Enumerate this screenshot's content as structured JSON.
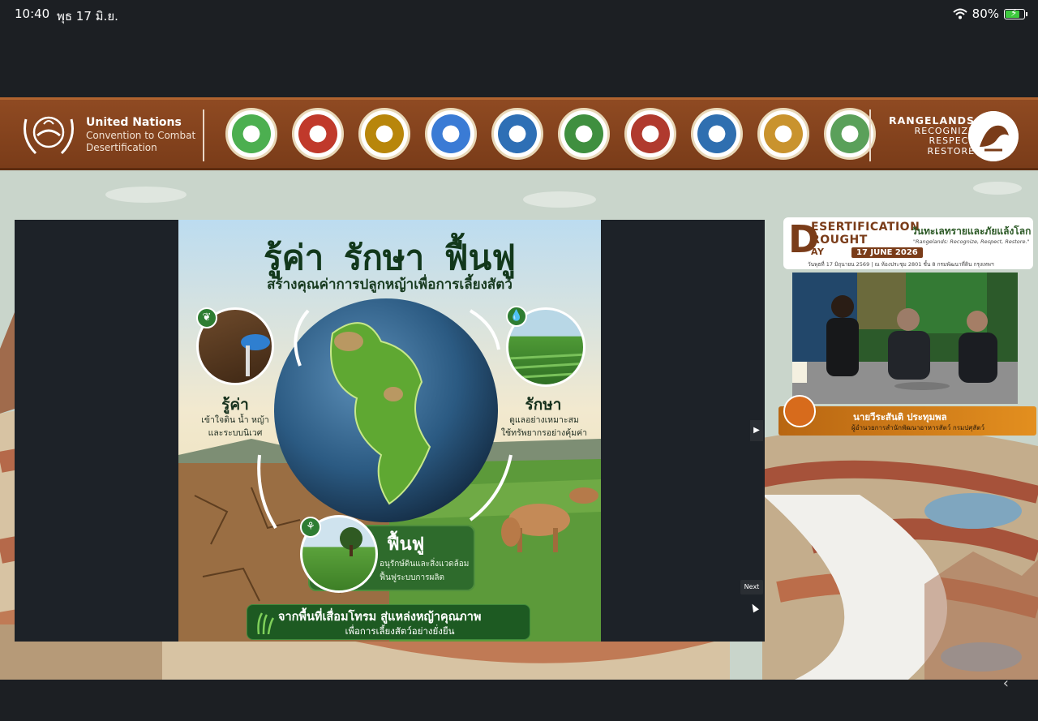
{
  "status_bar": {
    "time": "10:40",
    "date": "พุธ 17 มิ.ย.",
    "battery": "80%",
    "battery_level": 0.8
  },
  "banner": {
    "org_title": "United Nations",
    "org_sub1": "Convention to Combat",
    "org_sub2": "Desertification",
    "campaign": [
      "RANGELANDS",
      "RECOGNIZE",
      "RESPECT",
      "RESTORE"
    ],
    "partner_seal_count": 10
  },
  "slide": {
    "title": "รู้ค่า รักษา ฟื้นฟู",
    "subtitle": "สร้างคุณค่าการปลูกหญ้าเพื่อการเลี้ยงสัตว์",
    "left_head": "รู้ค่า",
    "left_text1": "เข้าใจดิน น้ำ หญ้า",
    "left_text2": "และระบบนิเวศ",
    "right_head": "รักษา",
    "right_text1": "ดูแลอย่างเหมาะสม",
    "right_text2": "ใช้ทรัพยากรอย่างคุ้มค่า",
    "bottom_head": "ฟื้นฟู",
    "bottom_text1": "อนุรักษ์ดินและสิ่งแวดล้อม",
    "bottom_text2": "ฟื้นฟูระบบการผลิต",
    "footer1": "จากพื้นที่เสื่อมโทรม สู่แหล่งหญ้าคุณภาพ",
    "footer2": "เพื่อการเลี้ยงสัตว์อย่างยั่งยืน"
  },
  "event": {
    "letter": "D",
    "line1": "ESERTIFICATION",
    "line2": "ROUGHT",
    "day": "AY",
    "date": "17 JUNE 2026",
    "thai_title": "วันทะเลทรายและภัยแล้งโลก",
    "tagline": "\"Rangelands: Recognize, Respect, Restore.\"",
    "note": "วันพุธที่ 17 มิถุนายน 2569 | ณ ห้องประชุม 2801 ชั้น 8 กรมพัฒนาที่ดิน กรุงเทพฯ"
  },
  "speaker": {
    "name": "นายวีระสันติ ประทุมพล",
    "title": "ผู้อำนวยการสำนักพัฒนาอาหารสัตว์ กรมปศุสัตว์"
  },
  "controls": {
    "next_label": "Next",
    "nav_arrow": "▶",
    "chevron": "‹"
  },
  "colors": {
    "banner_brown": "#7a3c19",
    "slide_green": "#2e6b2c",
    "nameplate_orange": "#e38f1f"
  }
}
